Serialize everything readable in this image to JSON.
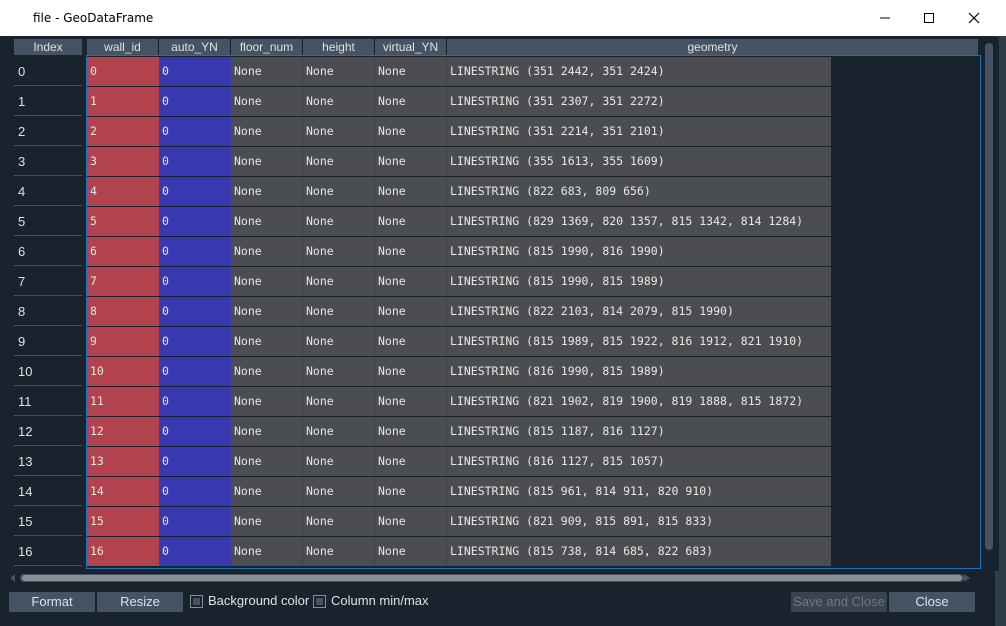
{
  "window": {
    "title": "file - GeoDataFrame"
  },
  "table": {
    "index_header": "Index",
    "columns": [
      "wall_id",
      "auto_YN",
      "floor_num",
      "height",
      "virtual_YN",
      "geometry"
    ],
    "rows": [
      {
        "index": "0",
        "wall_id": "0",
        "auto_YN": "0",
        "floor_num": "None",
        "height": "None",
        "virtual_YN": "None",
        "geometry": "LINESTRING (351 2442, 351 2424)"
      },
      {
        "index": "1",
        "wall_id": "1",
        "auto_YN": "0",
        "floor_num": "None",
        "height": "None",
        "virtual_YN": "None",
        "geometry": "LINESTRING (351 2307, 351 2272)"
      },
      {
        "index": "2",
        "wall_id": "2",
        "auto_YN": "0",
        "floor_num": "None",
        "height": "None",
        "virtual_YN": "None",
        "geometry": "LINESTRING (351 2214, 351 2101)"
      },
      {
        "index": "3",
        "wall_id": "3",
        "auto_YN": "0",
        "floor_num": "None",
        "height": "None",
        "virtual_YN": "None",
        "geometry": "LINESTRING (355 1613, 355 1609)"
      },
      {
        "index": "4",
        "wall_id": "4",
        "auto_YN": "0",
        "floor_num": "None",
        "height": "None",
        "virtual_YN": "None",
        "geometry": "LINESTRING (822 683, 809 656)"
      },
      {
        "index": "5",
        "wall_id": "5",
        "auto_YN": "0",
        "floor_num": "None",
        "height": "None",
        "virtual_YN": "None",
        "geometry": "LINESTRING (829 1369, 820 1357, 815 1342, 814 1284)"
      },
      {
        "index": "6",
        "wall_id": "6",
        "auto_YN": "0",
        "floor_num": "None",
        "height": "None",
        "virtual_YN": "None",
        "geometry": "LINESTRING (815 1990, 816 1990)"
      },
      {
        "index": "7",
        "wall_id": "7",
        "auto_YN": "0",
        "floor_num": "None",
        "height": "None",
        "virtual_YN": "None",
        "geometry": "LINESTRING (815 1990, 815 1989)"
      },
      {
        "index": "8",
        "wall_id": "8",
        "auto_YN": "0",
        "floor_num": "None",
        "height": "None",
        "virtual_YN": "None",
        "geometry": "LINESTRING (822 2103, 814 2079, 815 1990)"
      },
      {
        "index": "9",
        "wall_id": "9",
        "auto_YN": "0",
        "floor_num": "None",
        "height": "None",
        "virtual_YN": "None",
        "geometry": "LINESTRING (815 1989, 815 1922, 816 1912, 821 1910)"
      },
      {
        "index": "10",
        "wall_id": "10",
        "auto_YN": "0",
        "floor_num": "None",
        "height": "None",
        "virtual_YN": "None",
        "geometry": "LINESTRING (816 1990, 815 1989)"
      },
      {
        "index": "11",
        "wall_id": "11",
        "auto_YN": "0",
        "floor_num": "None",
        "height": "None",
        "virtual_YN": "None",
        "geometry": "LINESTRING (821 1902, 819 1900, 819 1888, 815 1872)"
      },
      {
        "index": "12",
        "wall_id": "12",
        "auto_YN": "0",
        "floor_num": "None",
        "height": "None",
        "virtual_YN": "None",
        "geometry": "LINESTRING (815 1187, 816 1127)"
      },
      {
        "index": "13",
        "wall_id": "13",
        "auto_YN": "0",
        "floor_num": "None",
        "height": "None",
        "virtual_YN": "None",
        "geometry": "LINESTRING (816 1127, 815 1057)"
      },
      {
        "index": "14",
        "wall_id": "14",
        "auto_YN": "0",
        "floor_num": "None",
        "height": "None",
        "virtual_YN": "None",
        "geometry": "LINESTRING (815 961, 814 911, 820 910)"
      },
      {
        "index": "15",
        "wall_id": "15",
        "auto_YN": "0",
        "floor_num": "None",
        "height": "None",
        "virtual_YN": "None",
        "geometry": "LINESTRING (821 909, 815 891, 815 833)"
      },
      {
        "index": "16",
        "wall_id": "16",
        "auto_YN": "0",
        "floor_num": "None",
        "height": "None",
        "virtual_YN": "None",
        "geometry": "LINESTRING (815 738, 814 685, 822 683)"
      }
    ]
  },
  "footer": {
    "format_label": "Format",
    "resize_label": "Resize",
    "background_color_label": "Background color",
    "column_minmax_label": "Column min/max",
    "save_close_label": "Save and Close",
    "close_label": "Close"
  },
  "colors": {
    "wall_id_bg": "#b2434e",
    "auto_YN_bg": "#3838b0",
    "other_bg": "#4c4d50",
    "selection_border": "#1a72bb"
  }
}
